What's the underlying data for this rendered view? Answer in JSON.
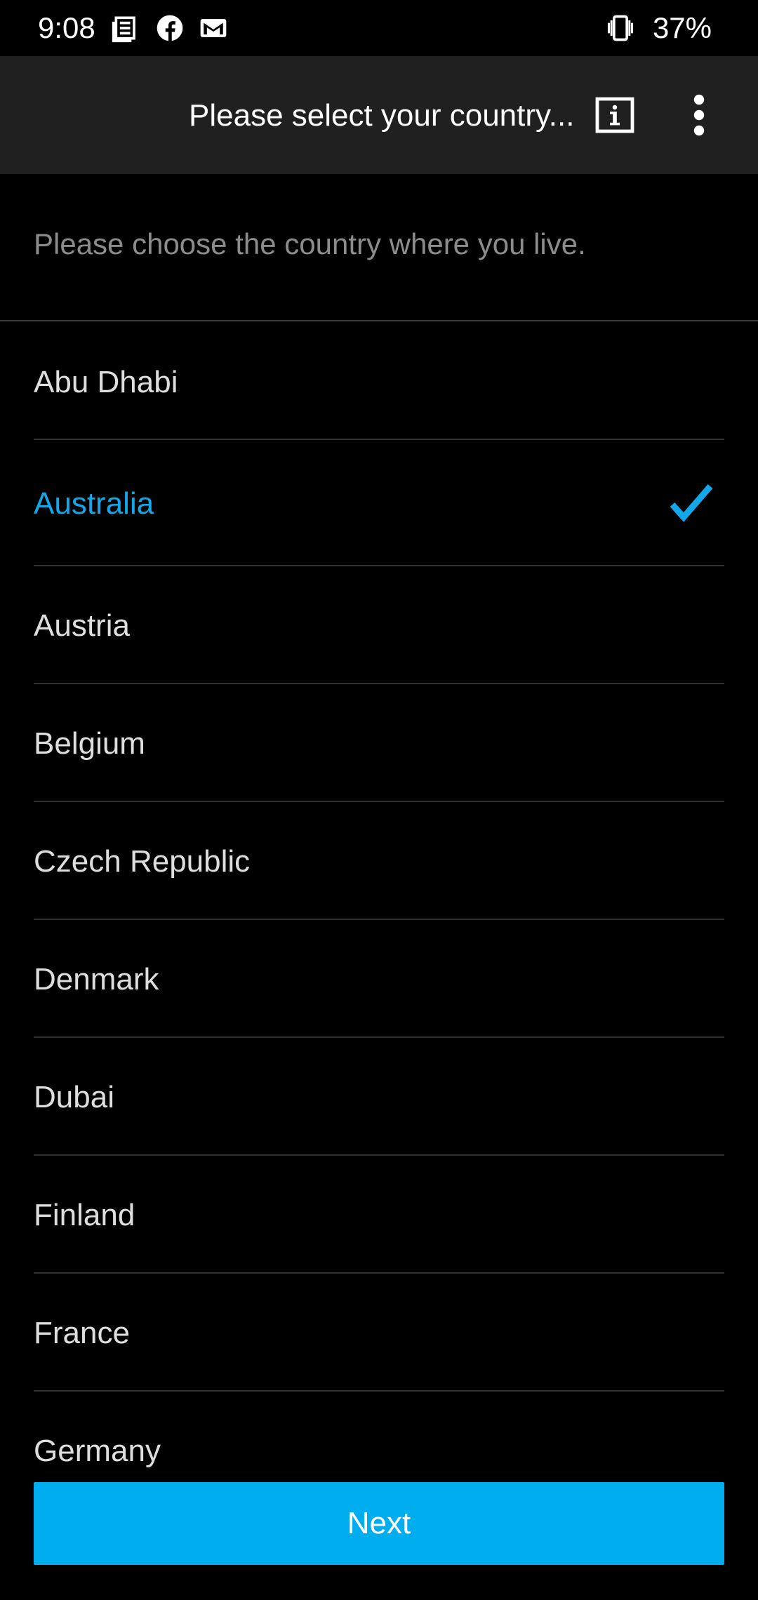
{
  "status_bar": {
    "time": "9:08",
    "left_icons": [
      "news-icon",
      "facebook-icon",
      "gmail-icon"
    ],
    "vibrate_icon": "vibrate-icon",
    "battery": "37%"
  },
  "app_bar": {
    "title": "Please select your country...",
    "info_icon": "info-icon",
    "menu_icon": "overflow-menu-icon"
  },
  "intro": {
    "text": "Please choose the country where you live."
  },
  "countries": [
    {
      "label": "Abu Dhabi",
      "selected": false
    },
    {
      "label": "Australia",
      "selected": true
    },
    {
      "label": "Austria",
      "selected": false
    },
    {
      "label": "Belgium",
      "selected": false
    },
    {
      "label": "Czech Republic",
      "selected": false
    },
    {
      "label": "Denmark",
      "selected": false
    },
    {
      "label": "Dubai",
      "selected": false
    },
    {
      "label": "Finland",
      "selected": false
    },
    {
      "label": "France",
      "selected": false
    },
    {
      "label": "Germany",
      "selected": false
    }
  ],
  "next_button": {
    "label": "Next"
  },
  "colors": {
    "accent": "#00AEEF",
    "selected_text": "#12A7E8",
    "background": "#000000",
    "app_bar": "#202020"
  }
}
